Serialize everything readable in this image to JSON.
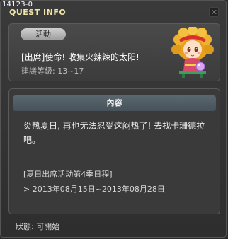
{
  "window": {
    "quest_id": "14123-0",
    "title": "QUEST INFO"
  },
  "summary": {
    "category": "活動",
    "quest_name": "[出席]使命! 收集火辣辣的太阳!",
    "level_requirement": "建議等級: 13~17",
    "npc_icon": "npc-portrait-icon"
  },
  "content": {
    "header": "內容",
    "description": "炎热夏日, 再也无法忍受这闷热了! 去找卡珊德拉吧。",
    "event_title": "[夏日出席活动第4季日程]",
    "event_date": "> 2013年08月15日~2013年08月28日"
  },
  "status": {
    "text": "狀態: 可開始"
  },
  "colors": {
    "title": "#f0e6a8",
    "panel": "#3a3a3a",
    "header_bar": "#51606a",
    "badge": "#b8b8b8"
  }
}
